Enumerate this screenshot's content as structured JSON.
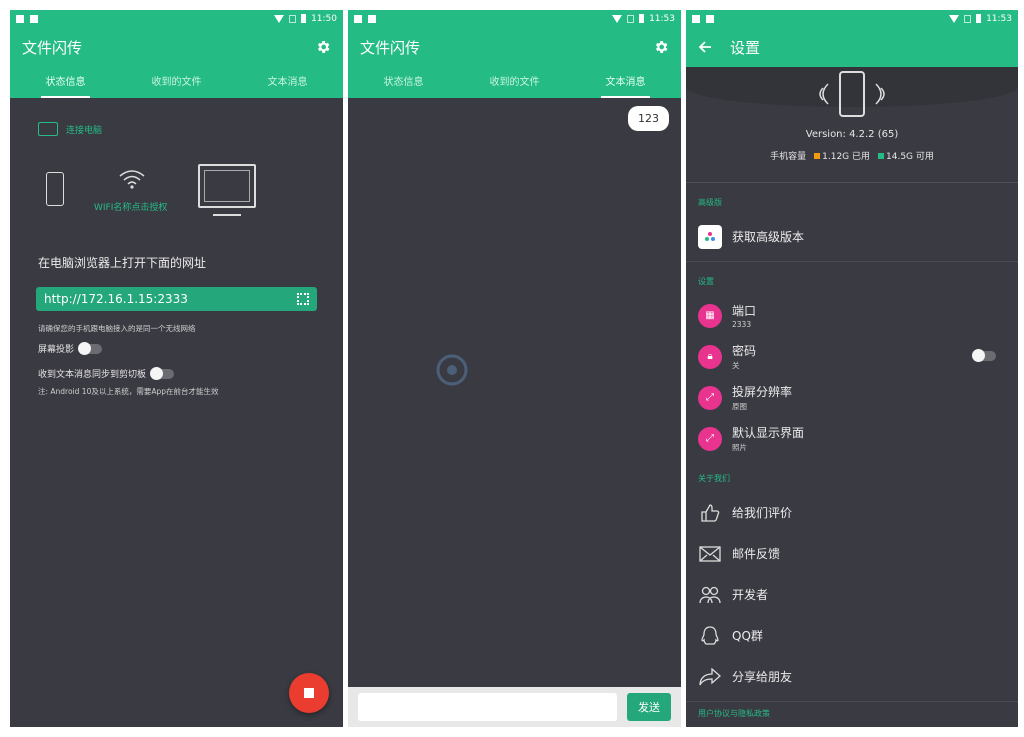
{
  "screen1": {
    "status": {
      "time": "11:50"
    },
    "app_title": "文件闪传",
    "tabs": [
      "状态信息",
      "收到的文件",
      "文本消息"
    ],
    "connect_label": "连接电脑",
    "wifi_label": "WIFI名称点击授权",
    "open_label": "在电脑浏览器上打开下面的网址",
    "url": "http://172.16.1.15:2333",
    "network_note": "请确保您的手机跟电脑接入的是同一个无线网络",
    "screen_cast_label": "屏幕投影",
    "sync_clipboard_label": "收到文本消息同步到剪切板",
    "android_note": "注: Android 10及以上系统，需要App在前台才能生效"
  },
  "screen2": {
    "status": {
      "time": "11:53"
    },
    "app_title": "文件闪传",
    "tabs": [
      "状态信息",
      "收到的文件",
      "文本消息"
    ],
    "message": "123",
    "send_label": "发送"
  },
  "screen3": {
    "status": {
      "time": "11:53"
    },
    "title": "设置",
    "version": "Version: 4.2.2 (65)",
    "storage_label": "手机容量",
    "used": "1.12G 已用",
    "free": "14.5G 可用",
    "premium_section": "高级版",
    "get_premium": "获取高级版本",
    "settings_section": "设置",
    "port_label": "端口",
    "port_value": "2333",
    "password_label": "密码",
    "password_value": "关",
    "resolution_label": "投屏分辨率",
    "resolution_value": "原图",
    "default_view_label": "默认显示界面",
    "default_view_value": "照片",
    "about_section": "关于我们",
    "rate_label": "给我们评价",
    "feedback_label": "邮件反馈",
    "developer_label": "开发者",
    "qq_label": "QQ群",
    "share_label": "分享给朋友",
    "policy_label": "用户协议与隐私政策"
  },
  "colors": {
    "accent": "#24bb85",
    "dark_bg": "#3a3a42",
    "fab": "#ea3d2f",
    "pink": "#e8338f",
    "used": "#f39c12"
  }
}
